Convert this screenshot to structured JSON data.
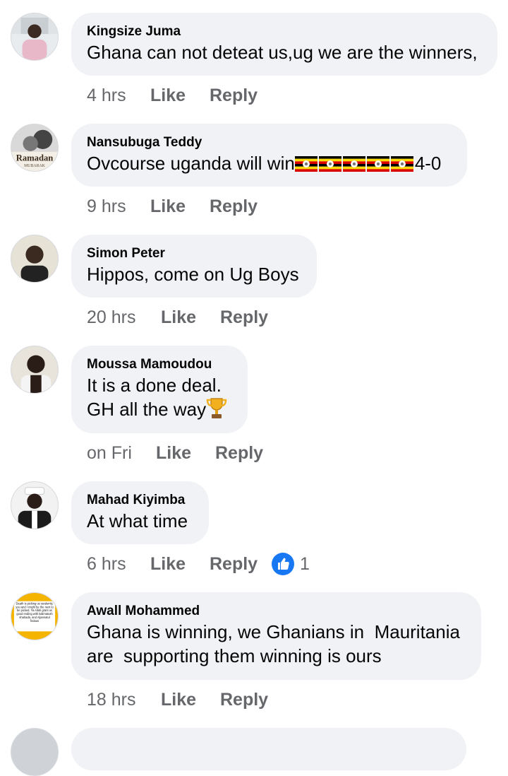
{
  "comments": [
    {
      "author": "Kingsize Juma",
      "text": [
        "Ghana can not deteat us,ug we are the winners,"
      ],
      "time": "4 hrs",
      "like": "Like",
      "reply": "Reply"
    },
    {
      "author": "Nansubuga Teddy",
      "text": [
        "Ovcourse uganda will win"
      ],
      "text_suffix": "4-0",
      "flag_count": 5,
      "avatar_text": [
        "Ramadan",
        "MUBARAK"
      ],
      "time": "9 hrs",
      "like": "Like",
      "reply": "Reply"
    },
    {
      "author": "Simon Peter",
      "text": [
        "Hippos, come on Ug Boys"
      ],
      "time": "20 hrs",
      "like": "Like",
      "reply": "Reply"
    },
    {
      "author": "Moussa Mamoudou",
      "text": [
        "It is a done deal.",
        "GH all the way"
      ],
      "time": "on Fri",
      "like": "Like",
      "reply": "Reply"
    },
    {
      "author": "Mahad Kiyimba",
      "text": [
        "At what time"
      ],
      "time": "6 hrs",
      "like": "Like",
      "reply": "Reply",
      "reaction_count": "1"
    },
    {
      "author": "Awall Mohammed",
      "text": [
        "Ghana is winning, we Ghanians in  Mauritania",
        "are  supporting them winning is ours"
      ],
      "avatar_text": "Death is picking us randomly, you and I might be the next to be picked. Ya Allah grant us good ending with kalimatush shahada, and Aljannatul firdaus",
      "time": "18 hrs",
      "like": "Like",
      "reply": "Reply"
    }
  ],
  "colors": {
    "bubble": "#f0f2f5",
    "meta_text": "#65676b",
    "like_reaction": "#1877f2",
    "uganda_black": "#000000",
    "uganda_yellow": "#fcdc04",
    "uganda_red": "#d90000"
  },
  "icons": {
    "trophy": "trophy-icon",
    "flag": "uganda-flag-icon",
    "reaction": "like-reaction-icon"
  }
}
